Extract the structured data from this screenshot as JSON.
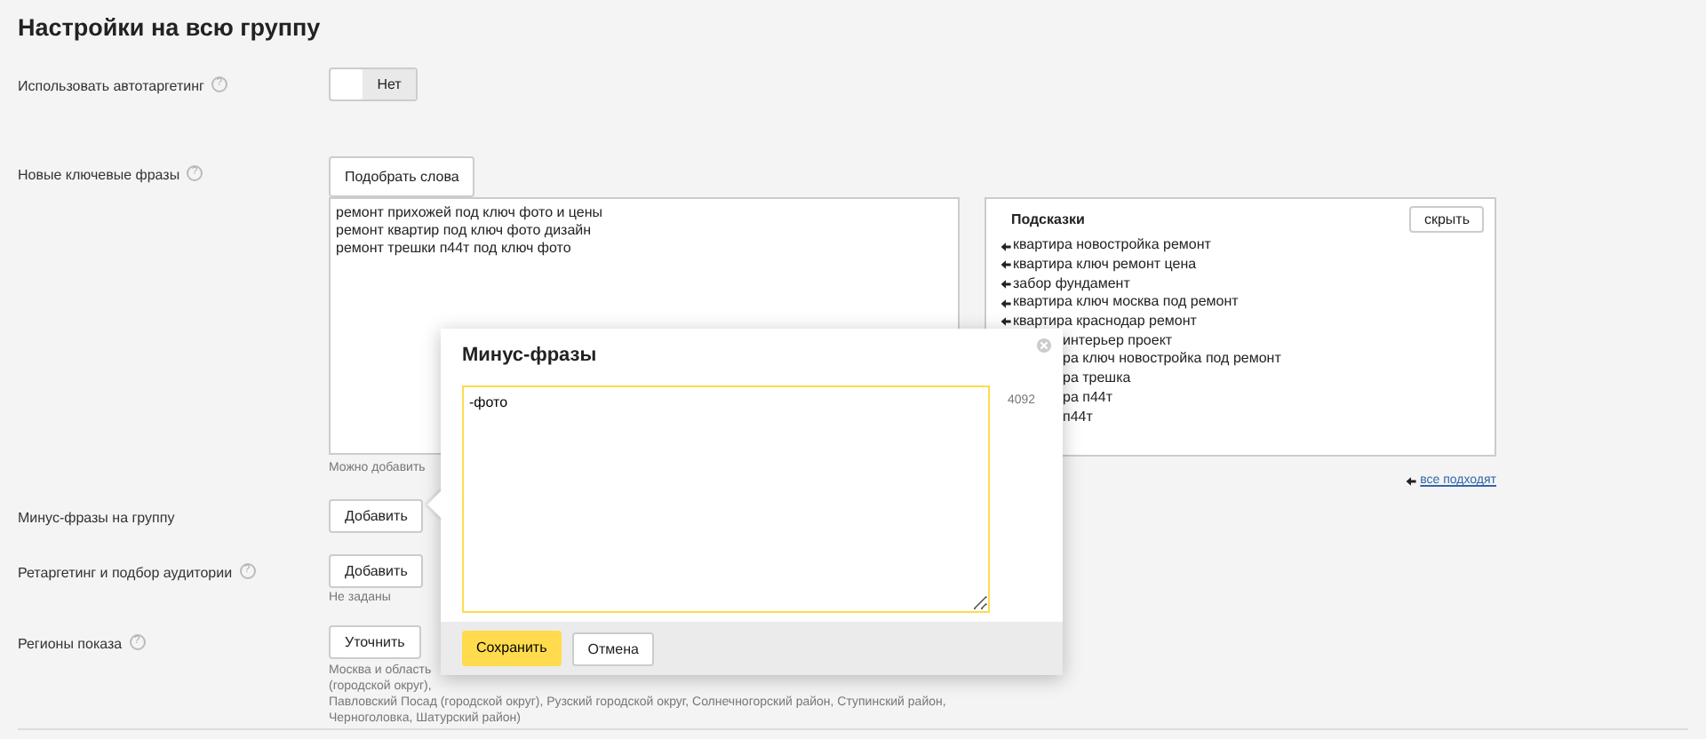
{
  "heading": "Настройки на всю группу",
  "autotargeting": {
    "label": "Использовать автотаргетинг",
    "help": "?",
    "on": false,
    "value_label": "Нет"
  },
  "keywords": {
    "label": "Новые ключевые фразы",
    "help": "?",
    "pick_button": "Подобрать слова",
    "phrases": [
      "ремонт прихожей под ключ фото и цены",
      "ремонт квартир под ключ фото дизайн",
      "ремонт трешки п44т под ключ фото"
    ],
    "hint": "Можно добавить"
  },
  "suggestions": {
    "title": "Подсказки",
    "hide_button": "скрыть",
    "items": [
      {
        "text": "квартира новостройка ремонт",
        "kind": "link"
      },
      {
        "text": "квартира ключ ремонт цена",
        "kind": "link"
      },
      {
        "text": "забор фундамент",
        "kind": "link"
      },
      {
        "text": "квартира ключ москва под ремонт",
        "kind": "link"
      },
      {
        "text": "квартира краснодар ремонт",
        "kind": "link"
      },
      {
        "text": "интерьер проект",
        "kind": "covered"
      },
      {
        "text": "ра ключ новостройка под ремонт",
        "kind": "covered"
      },
      {
        "text": "ра трешка",
        "kind": "covered"
      },
      {
        "text": "ра п44т",
        "kind": "covered"
      },
      {
        "text": "п44т",
        "kind": "covered"
      }
    ],
    "all_fit": "все подходят"
  },
  "minus_phrases": {
    "label": "Минус-фразы на группу",
    "button": "Добавить"
  },
  "retargeting": {
    "label": "Ретаргетинг и подбор аудитории",
    "help": "?",
    "button": "Добавить",
    "status": "Не заданы"
  },
  "regions": {
    "label": "Регионы показа",
    "help": "?",
    "button": "Уточнить",
    "lines": [
      "Москва и область",
      "(городской округ),",
      "Павловский Посад (городской округ), Рузский городской округ, Солнечногорский район, Ступинский район, Черноголовка, Шатурский район)"
    ]
  },
  "popup": {
    "title": "Минус-фразы",
    "value": "-фото",
    "counter": "4092",
    "save": "Сохранить",
    "cancel": "Отмена"
  }
}
